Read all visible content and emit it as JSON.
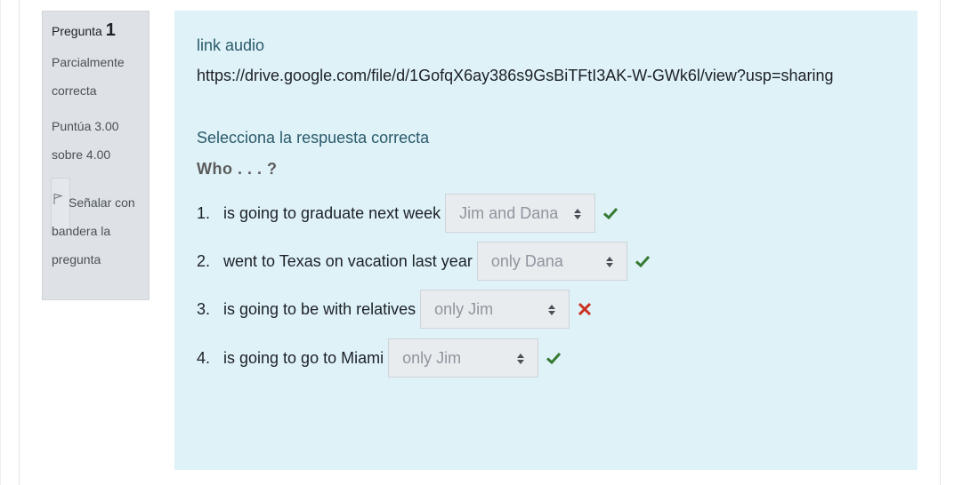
{
  "info": {
    "question_word": "Pregunta",
    "question_number": "1",
    "state_line1": "Parcialmente",
    "state_line2": "correcta",
    "grade_line1": "Puntúa 3.00",
    "grade_line2": "sobre 4.00",
    "flag_line1": "Señalar con",
    "flag_line2": "bandera la",
    "flag_line3": "pregunta"
  },
  "content": {
    "link_label": "link audio",
    "link_url": "https://drive.google.com/file/d/1GofqX6ay386s9GsBiTFtI3AK-W-GWk6l/view?usp=sharing",
    "prompt": "Selecciona la respuesta correcta",
    "who": "Who . . . ?",
    "items": [
      {
        "num": "1.",
        "stem": "is going to graduate next week",
        "selected": "Jim and Dana",
        "result": "correct"
      },
      {
        "num": "2.",
        "stem": "went to Texas on vacation last year",
        "selected": "only Dana",
        "result": "correct"
      },
      {
        "num": "3.",
        "stem": "is going to be with relatives",
        "selected": "only Jim",
        "result": "incorrect"
      },
      {
        "num": "4.",
        "stem": "is going to go to Miami",
        "selected": "only Jim",
        "result": "correct"
      }
    ]
  },
  "colors": {
    "content_bg": "#def2f8",
    "info_bg": "#dee2e6",
    "correct": "#357a32",
    "incorrect": "#ca3120"
  },
  "icons": [
    "flag-icon",
    "select-caret-icon",
    "check-icon",
    "cross-icon"
  ]
}
